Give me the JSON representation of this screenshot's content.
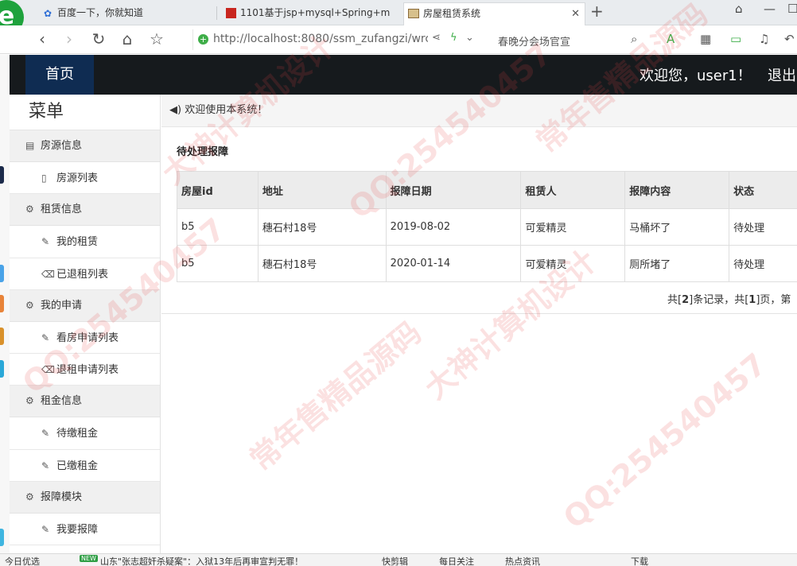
{
  "browser": {
    "logo_letter": "e",
    "tabs": [
      {
        "title": "百度一下，你就知道",
        "favicon": "paw-icon"
      },
      {
        "title": "1101基于jsp+mysql+Spring+m",
        "favicon": "red-square-icon"
      },
      {
        "title": "房屋租赁系统",
        "favicon": "image-icon"
      }
    ],
    "url": "http://localhost:8080/ssm_zufangzi/wrc",
    "search_hint": "春晚分会场官宣"
  },
  "header": {
    "home_label": "首页",
    "welcome": "欢迎您，user1！",
    "logout_label": "退出"
  },
  "sidebar": {
    "title": "菜单",
    "groups": [
      {
        "label": "房源信息",
        "icon": "list-icon",
        "items": [
          {
            "label": "房源列表",
            "icon": "file-icon"
          }
        ]
      },
      {
        "label": "租赁信息",
        "icon": "gear-icon",
        "items": [
          {
            "label": "我的租赁",
            "icon": "wrench-icon"
          },
          {
            "label": "已退租列表",
            "icon": "trash-icon"
          }
        ]
      },
      {
        "label": "我的申请",
        "icon": "gear-icon",
        "items": [
          {
            "label": "看房申请列表",
            "icon": "wrench-icon"
          },
          {
            "label": "退租申请列表",
            "icon": "trash-icon"
          }
        ]
      },
      {
        "label": "租金信息",
        "icon": "gear-icon",
        "items": [
          {
            "label": "待缴租金",
            "icon": "wrench-icon"
          },
          {
            "label": "已缴租金",
            "icon": "wrench-icon"
          }
        ]
      },
      {
        "label": "报障模块",
        "icon": "gear-icon",
        "items": [
          {
            "label": "我要报障",
            "icon": "wrench-icon"
          }
        ]
      }
    ]
  },
  "main": {
    "notice": "欢迎使用本系统！",
    "panel_title": "待处理报障",
    "table": {
      "headers": [
        "房屋id",
        "地址",
        "报障日期",
        "租赁人",
        "报障内容",
        "状态"
      ],
      "rows": [
        [
          "b5",
          "穗石村18号",
          "2019-08-02",
          "可爱精灵",
          "马桶坏了",
          "待处理"
        ],
        [
          "b5",
          "穗石村18号",
          "2020-01-14",
          "可爱精灵",
          "厕所堵了",
          "待处理"
        ]
      ]
    },
    "pager": {
      "prefix": "共[",
      "total": "2",
      "mid": "]条记录，共[",
      "pages": "1",
      "suffix": "]页，第"
    }
  },
  "watermark": {
    "texts": [
      "大神计算机设计",
      "QQ:254540457",
      "常年售精品源码"
    ]
  },
  "bottombar": {
    "items": [
      "今日优选",
      "NEW",
      "山东\"张志超奸杀疑案\"：入狱13年后再审宣判无罪！",
      "快剪辑",
      "每日关注",
      "热点资讯",
      "下载"
    ]
  }
}
